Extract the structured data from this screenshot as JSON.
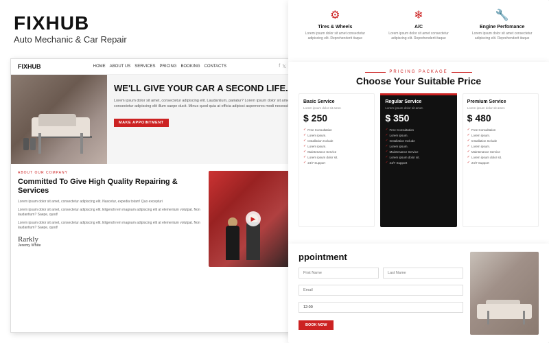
{
  "brand": {
    "title": "FIXHUB",
    "subtitle": "Auto Mechanic & Car Repair"
  },
  "nav": {
    "logo": "FIXHUB",
    "links": [
      "HOME",
      "ABOUT US",
      "SERVICES",
      "PRICING",
      "BOOKING",
      "CONTACTS"
    ]
  },
  "hero": {
    "headline": "WE'LL GIVE YOUR CAR A SECOND LIFE.",
    "description": "Lorem ipsum dolor sit amet, consectetur adipiscing elit. Laudantium, pariatur? Lorem ipsum dolor sit amet consectetur adipiscing elit illum saepe ducit. Minus quod quia at officia adipisci aspernores modi necessiis.",
    "button": "MAKE APPOINTMENT"
  },
  "about": {
    "label": "ABOUT OUR COMPANY",
    "heading": "Committed To Give High Quality Repairing & Services",
    "para1": "Lorem ipsum dolor sit amet, consectetur adipiscing elit. Nascetur, expedia totam! Quo excepturi",
    "para2": "Lorem ipsum dolor sit amet, consectetur adipiscing elit. Eligendi rem magnam adipiscing elit at elementum volutpat. Non laudantium? Saepe, quod!",
    "para3": "Lorem ipsum dolor sit amet, consectetur adipiscing elit. Eligendi rem magnam adipiscing elit at elementum volutpat. Non laudantium? Saepe, quod!",
    "signature": "Jeremy White",
    "sig_name": "Jeremy White"
  },
  "services": {
    "items": [
      {
        "name": "Tires & Wheels",
        "desc": "Lorem ipsum dolor sit amet consectetur adipiscing elit. Reprehenderit itaque",
        "icon": "⚙"
      },
      {
        "name": "A/C",
        "desc": "Lorem ipsum dolor sit amet consectetur adipiscing elit. Reprehenderit itaque",
        "icon": "❄"
      },
      {
        "name": "Engine Perfomance",
        "desc": "Lorem ipsum dolor sit amet consectetur adipiscing elit. Reprehenderit itaque",
        "icon": "🔧"
      }
    ]
  },
  "pricing": {
    "label": "PRICING PACKAGE",
    "title": "Choose Your Suitable Price",
    "plans": [
      {
        "name": "Basic Service",
        "desc": "Lorem ipsum dolor sit amet.",
        "price": "$ 250",
        "features": [
          "Free Consultation",
          "Lorem ipsum.",
          "Installation Include",
          "Lorem ipsum.",
          "Maintenance Service",
          "Lorem ipsum dolor sit.",
          "24/7 Support"
        ],
        "highlighted": false
      },
      {
        "name": "Regular Service",
        "desc": "Lorem ipsum dolor sit amet.",
        "price": "$ 350",
        "features": [
          "Free Consultation",
          "Lorem ipsum.",
          "Installation Include",
          "Lorem ipsum.",
          "Maintenance Service",
          "Lorem ipsum dolor sit.",
          "24/7 Support"
        ],
        "highlighted": true
      },
      {
        "name": "Premium Service",
        "desc": "Lorem ipsum dolor sit amet.",
        "price": "$ 480",
        "features": [
          "Free Consultation",
          "Lorem ipsum.",
          "Installation Include",
          "Lorem ipsum.",
          "Maintenance Service",
          "Lorem ipsum dolor sit.",
          "24/7 Support"
        ],
        "highlighted": false
      }
    ]
  },
  "appointment": {
    "title": "ppointment",
    "fields": {
      "first_name": "First Name",
      "last_name": "Last Name",
      "email": "Email",
      "time": "12:00",
      "button": "BOOK NOW"
    }
  }
}
